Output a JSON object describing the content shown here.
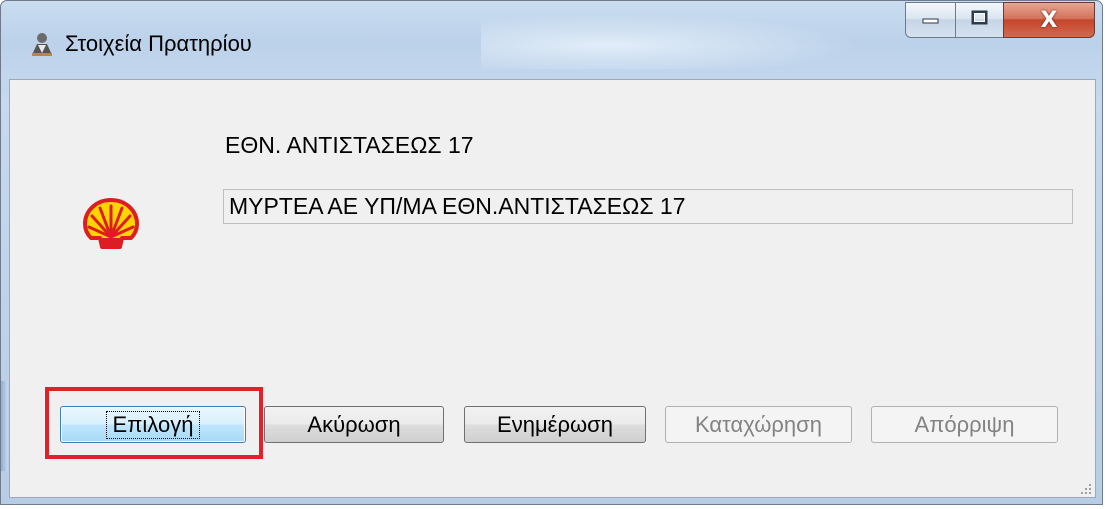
{
  "window": {
    "title": "Στοιχεία Πρατηρίου",
    "title_icon": "people-icon",
    "caption": {
      "minimize_icon": "minimize-icon",
      "maximize_icon": "maximize-icon",
      "close_icon": "close-icon",
      "close_glyph": "X"
    }
  },
  "station": {
    "logo": "shell-logo-icon",
    "address": "ΕΘΝ. ΑΝΤΙΣΤΑΣΕΩΣ 17",
    "name": "ΜΥΡΤΕΑ ΑΕ ΥΠ/ΜΑ ΕΘΝ.ΑΝΤΙΣΤΑΣΕΩΣ 17"
  },
  "buttons": {
    "select": "Επιλογή",
    "cancel": "Ακύρωση",
    "update": "Ενημέρωση",
    "register": "Καταχώρηση",
    "reject": "Απόρριψη"
  },
  "colors": {
    "highlight": "#e0202a",
    "shell_yellow": "#ffd500",
    "shell_red": "#dd1d21",
    "close_red": "#c4462b"
  }
}
